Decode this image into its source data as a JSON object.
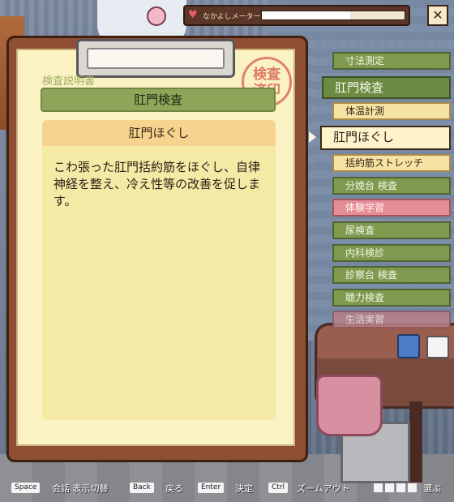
{
  "meter": {
    "label": "なかよしメーター",
    "level_percent": 62
  },
  "close": {
    "label": "✕"
  },
  "clipboard": {
    "label": "検査説明書",
    "stamp_line1": "検査",
    "stamp_line2": "済印",
    "title": "肛門検査",
    "subtitle": "肛門ほぐし",
    "description": "こわ張った肛門括約筋をほぐし、自律神経を整え、冷え性等の改善を促します。"
  },
  "menu": {
    "items": [
      {
        "label": "寸法測定",
        "style": "green"
      },
      {
        "label": "肛門検査",
        "style": "green-dark"
      },
      {
        "label": "体温計測",
        "style": "cream"
      },
      {
        "label": "肛門ほぐし",
        "style": "selected"
      },
      {
        "label": "括約筋ストレッチ",
        "style": "cream"
      },
      {
        "label": "分娩台 検査",
        "style": "green"
      },
      {
        "label": "体験学習",
        "style": "pink"
      },
      {
        "label": "尿検査",
        "style": "green"
      },
      {
        "label": "内科検診",
        "style": "green"
      },
      {
        "label": "診察台 検査",
        "style": "green"
      },
      {
        "label": "聴力検査",
        "style": "green"
      },
      {
        "label": "生活実習",
        "style": "faded"
      }
    ]
  },
  "help": {
    "space_key": "Space",
    "space_text": "会話 表示切替",
    "back_key": "Back",
    "back_text": "戻る",
    "enter_key": "Enter",
    "enter_text": "決定",
    "ctrl_key": "Ctrl",
    "ctrl_text": "ズームアウト",
    "arrows_text": "選ぶ"
  },
  "colors": {
    "clipboard": "#8e4f34",
    "paper": "#fbf2c4",
    "menu_green": "#7f9a4f",
    "menu_pink": "#e58d95"
  }
}
